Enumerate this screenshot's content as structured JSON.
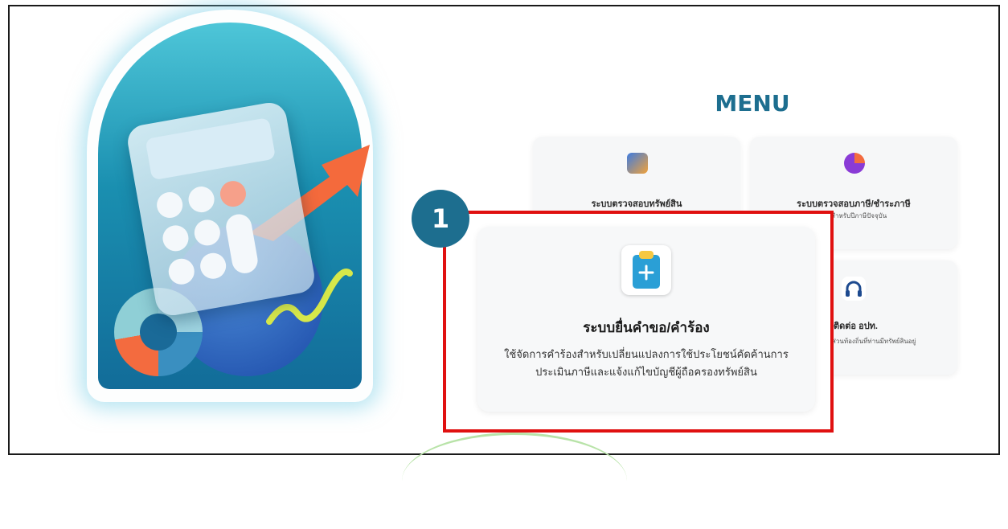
{
  "menu": {
    "title": "MENU"
  },
  "cards": [
    {
      "title": "ระบบตรวจสอบทรัพย์สิน",
      "desc": ""
    },
    {
      "title": "ระบบตรวจสอบภาษี/ชำระภาษี",
      "desc": "ประเภทต่างๆ สำหรับปีภาษีปัจจุบัน"
    },
    {
      "title": "ติดต่อ อปท.",
      "desc": "ส่วนท้องถิ่นที่ท่านมีทรัพย์สินอยู่"
    }
  ],
  "highlight": {
    "step": "1",
    "title": "ระบบยื่นคำขอ/คำร้อง",
    "desc_line1": "ใช้จัดการคำร้องสำหรับเปลี่ยนแปลงการใช้ประโยชน์คัดค้านการ",
    "desc_line2": "ประเมินภาษีและแจ้งแก้ไขบัญชีผู้ถือครองทรัพย์สิน"
  },
  "icons": {
    "property": "property-icon",
    "tax": "pie-chart-icon",
    "contact": "headset-icon",
    "request": "clipboard-plus-icon"
  },
  "colors": {
    "accent": "#1d6e8f",
    "highlight_border": "#e01010",
    "request_icon": "#2a9fd6"
  }
}
